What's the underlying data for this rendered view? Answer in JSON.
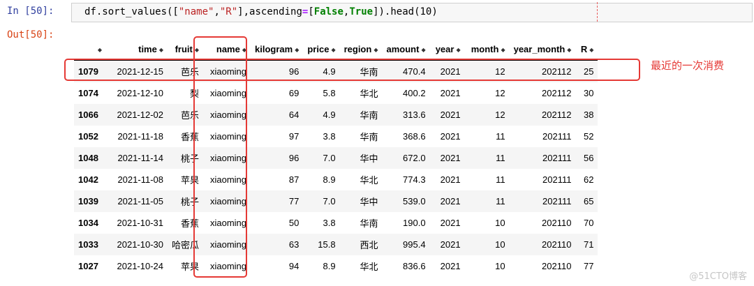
{
  "cell": {
    "in_prompt": "In [50]:",
    "out_prompt": "Out[50]:",
    "code": {
      "p1": "df.sort_values([",
      "s1": "\"name\"",
      "p2": ",",
      "s2": "\"R\"",
      "p3": "],ascending",
      "op": "=",
      "p4": "[",
      "kw1": "False",
      "p5": ",",
      "kw2": "True",
      "p6": "]).head(10)"
    }
  },
  "table": {
    "sort_icon": "sort-arrows-icon",
    "columns": [
      "",
      "time",
      "fruit",
      "name",
      "kilogram",
      "price",
      "region",
      "amount",
      "year",
      "month",
      "year_month",
      "R"
    ],
    "rows": [
      [
        "1079",
        "2021-12-15",
        "芭乐",
        "xiaoming",
        "96",
        "4.9",
        "华南",
        "470.4",
        "2021",
        "12",
        "202112",
        "25"
      ],
      [
        "1074",
        "2021-12-10",
        "梨",
        "xiaoming",
        "69",
        "5.8",
        "华北",
        "400.2",
        "2021",
        "12",
        "202112",
        "30"
      ],
      [
        "1066",
        "2021-12-02",
        "芭乐",
        "xiaoming",
        "64",
        "4.9",
        "华南",
        "313.6",
        "2021",
        "12",
        "202112",
        "38"
      ],
      [
        "1052",
        "2021-11-18",
        "香蕉",
        "xiaoming",
        "97",
        "3.8",
        "华南",
        "368.6",
        "2021",
        "11",
        "202111",
        "52"
      ],
      [
        "1048",
        "2021-11-14",
        "桃子",
        "xiaoming",
        "96",
        "7.0",
        "华中",
        "672.0",
        "2021",
        "11",
        "202111",
        "56"
      ],
      [
        "1042",
        "2021-11-08",
        "苹果",
        "xiaoming",
        "87",
        "8.9",
        "华北",
        "774.3",
        "2021",
        "11",
        "202111",
        "62"
      ],
      [
        "1039",
        "2021-11-05",
        "桃子",
        "xiaoming",
        "77",
        "7.0",
        "华中",
        "539.0",
        "2021",
        "11",
        "202111",
        "65"
      ],
      [
        "1034",
        "2021-10-31",
        "香蕉",
        "xiaoming",
        "50",
        "3.8",
        "华南",
        "190.0",
        "2021",
        "10",
        "202110",
        "70"
      ],
      [
        "1033",
        "2021-10-30",
        "哈密瓜",
        "xiaoming",
        "63",
        "15.8",
        "西北",
        "995.4",
        "2021",
        "10",
        "202110",
        "71"
      ],
      [
        "1027",
        "2021-10-24",
        "苹果",
        "xiaoming",
        "94",
        "8.9",
        "华北",
        "836.6",
        "2021",
        "10",
        "202110",
        "77"
      ]
    ]
  },
  "annotation": {
    "label": "最近的一次消费",
    "color": "#e53935"
  },
  "watermark": "@51CTO博客",
  "colors": {
    "in_prompt": "#303f9f",
    "out_prompt": "#d84315",
    "string": "#ba2121",
    "keyword": "#008000",
    "operator": "#aa22ff",
    "row_stripe": "#f5f5f5"
  }
}
